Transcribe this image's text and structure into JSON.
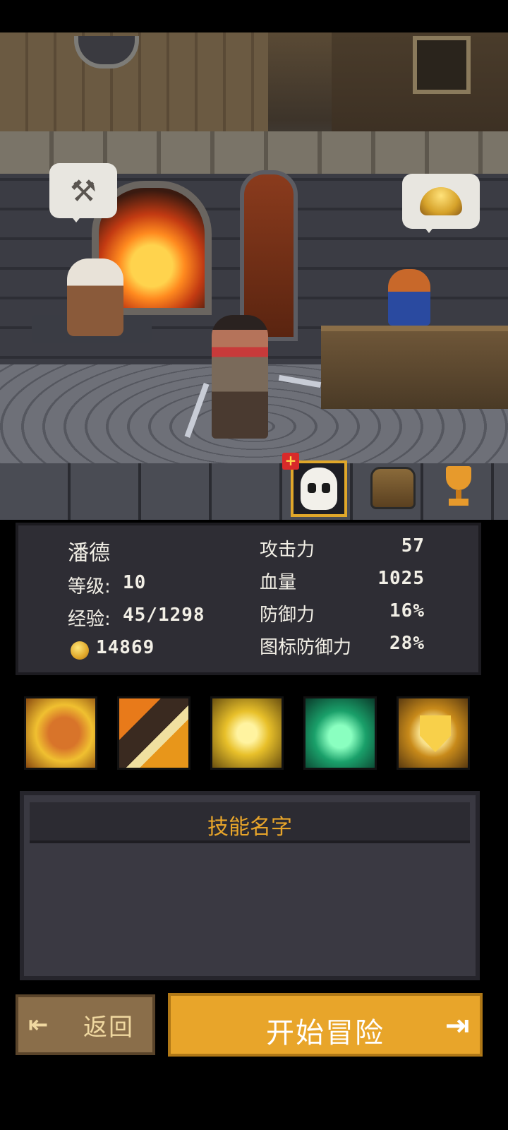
{
  "hud": {
    "skull_badge": "+"
  },
  "stats": {
    "hero_name": "潘德",
    "level_label": "等级:",
    "level_value": "10",
    "xp_label": "经验:",
    "xp_value": "45/1298",
    "gold_value": "14869",
    "attack_label": "攻击力",
    "attack_value": "57",
    "hp_label": "血量",
    "hp_value": "1025",
    "defense_label": "防御力",
    "defense_value": "16%",
    "icon_defense_label": "图标防御力",
    "icon_defense_value": "28%"
  },
  "skill_panel": {
    "title": "技能名字"
  },
  "footer": {
    "back_icon": "⇤",
    "back_label": "返回",
    "start_label": "开始冒险",
    "start_icon": "⇥"
  },
  "colors": {
    "accent": "#e8a52a",
    "panel": "#2e2d34",
    "back_button": "#8a6e4a"
  }
}
